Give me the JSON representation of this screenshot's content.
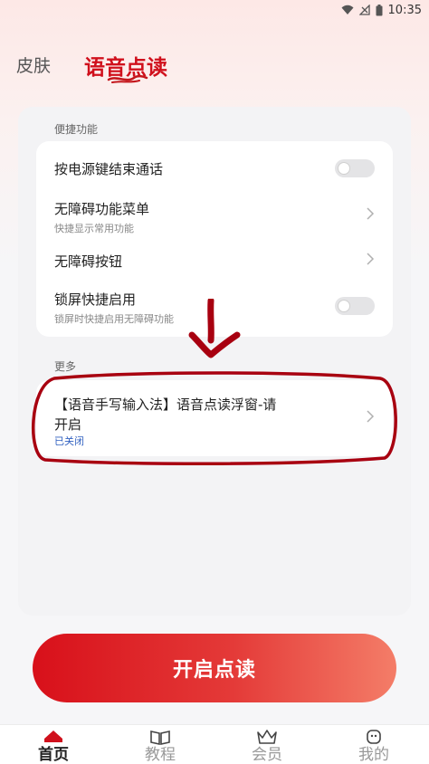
{
  "status_bar": {
    "time": "10:35",
    "icons": [
      "wifi-icon",
      "signal-icon",
      "battery-icon"
    ]
  },
  "header": {
    "tab_skin": "皮肤",
    "tab_active": "语音点读",
    "accent_color": "#d0101c"
  },
  "shortcuts": {
    "section_label": "便捷功能",
    "items": [
      {
        "title": "按电源键结束通话",
        "subtitle": "",
        "control": "toggle",
        "on": false
      },
      {
        "title": "无障碍功能菜单",
        "subtitle": "快捷显示常用功能",
        "control": "chevron-right-icon"
      },
      {
        "title": "无障碍按钮",
        "subtitle": "",
        "control": "chevron-right-icon"
      },
      {
        "title": "锁屏快捷启用",
        "subtitle": "锁屏时快捷启用无障碍功能",
        "control": "toggle",
        "on": false
      }
    ]
  },
  "more": {
    "section_label": "更多",
    "item_title_line1": "【语音手写输入法】语音点读浮窗-请",
    "item_title_line2": "开启",
    "item_status": "已关闭",
    "status_color": "#3060c0"
  },
  "cta": {
    "label": "开启点读",
    "colors": [
      "#d8101a",
      "#f47d68"
    ]
  },
  "bottom_nav": {
    "items": [
      {
        "label": "首页",
        "icon": "home-icon",
        "active": true
      },
      {
        "label": "教程",
        "icon": "book-icon",
        "active": false
      },
      {
        "label": "会员",
        "icon": "crown-icon",
        "active": false
      },
      {
        "label": "我的",
        "icon": "profile-icon",
        "active": false
      }
    ]
  }
}
